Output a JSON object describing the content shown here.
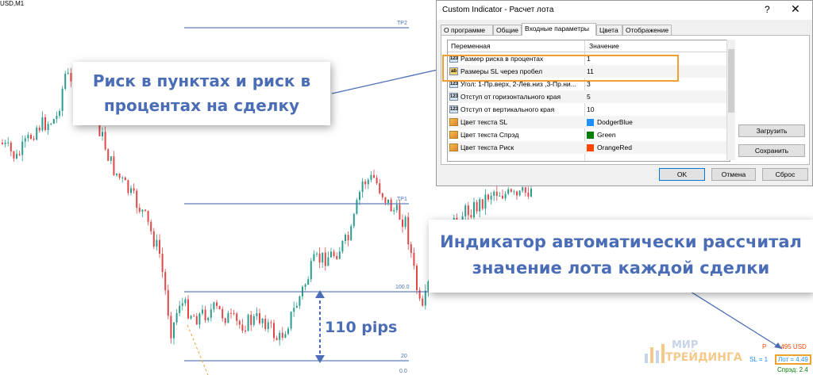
{
  "chart": {
    "title": "USD,M1",
    "levels": {
      "tp2": "TP2",
      "tp1": "TP1",
      "l100": "100.0",
      "l20": "20",
      "l0": "0.0"
    }
  },
  "callouts": {
    "risk_line1": "Риск в пунктах и риск в",
    "risk_line2": "процентах на сделку",
    "lot_line1": "Индикатор автоматически рассчитал",
    "lot_line2": "значение лота каждой сделки"
  },
  "pips_label": "110 pips",
  "dialog": {
    "title": "Custom Indicator - Расчет лота",
    "help": "?",
    "close": "✕",
    "tabs": [
      "О программе",
      "Общие",
      "Входные параметры",
      "Цвета",
      "Отображение"
    ],
    "columns": {
      "variable": "Переменная",
      "value": "Значение"
    },
    "rows": [
      {
        "icon": "123",
        "name": "Размер риска в процентах",
        "value": "1"
      },
      {
        "icon": "ab",
        "name": "Размеры SL через пробел",
        "value": "11"
      },
      {
        "icon": "123",
        "name": "Угол: 1-Пр.верх, 2-Лев.низ ,3-Пр.ни...",
        "value": "3"
      },
      {
        "icon": "123",
        "name": "Отступ от горизонтального края",
        "value": "5"
      },
      {
        "icon": "123",
        "name": "Отступ от вертикального края",
        "value": "10"
      },
      {
        "icon": "clr",
        "name": "Цвет текста SL",
        "value": "DodgerBlue",
        "color": "#1e90ff"
      },
      {
        "icon": "clr",
        "name": "Цвет текста Спрэд",
        "value": "Green",
        "color": "#008000"
      },
      {
        "icon": "clr",
        "name": "Цвет текста Риск",
        "value": "OrangeRed",
        "color": "#ff4500"
      }
    ],
    "buttons": {
      "load": "Загрузить",
      "save": "Сохранить",
      "ok": "OK",
      "cancel": "Отмена",
      "reset": "Сброс"
    }
  },
  "info": {
    "risk_prefix": "Р",
    "risk_value": "495 USD",
    "sl": "SL = 1",
    "lot": "Лот = 4.49",
    "spread": "Спрэд: 2.4"
  },
  "logo": {
    "line1": "МИР",
    "line2": "ТРЕЙДИНГА"
  },
  "colors": {
    "accent": "#4a6db6",
    "highlight": "#f0a030",
    "bull": "#2a9d8f",
    "bear": "#e04848"
  }
}
